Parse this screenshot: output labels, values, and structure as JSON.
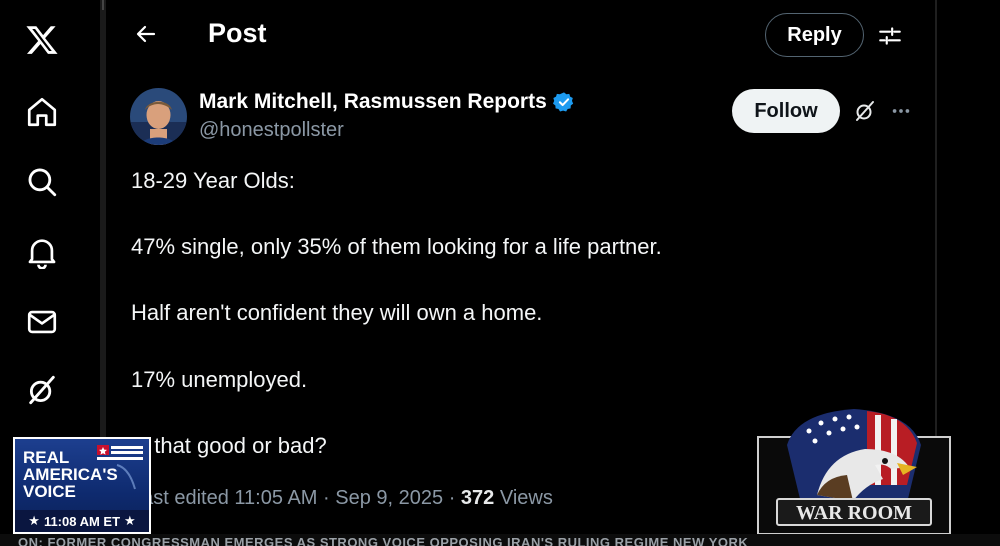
{
  "header": {
    "title": "Post",
    "reply_label": "Reply"
  },
  "author": {
    "name": "Mark Mitchell, Rasmussen Reports",
    "handle": "@honestpollster",
    "verified": true,
    "follow_label": "Follow"
  },
  "tweet": {
    "lines": [
      "18-29 Year Olds:",
      "47% single, only 35% of them looking for a life partner.",
      "Half aren't confident they will own a home.",
      "17% unemployed.",
      "Is that good or bad?"
    ]
  },
  "meta": {
    "edited_prefix": "Last edited",
    "time": "11:05 AM",
    "date": "Sep 9, 2025",
    "views_count": "372",
    "views_label": "Views",
    "separator": "·"
  },
  "nav": {
    "items": [
      "x-logo-icon",
      "home-icon",
      "search-icon",
      "notifications-icon",
      "messages-icon",
      "grok-icon"
    ]
  },
  "overlay": {
    "rav_line1": "REAL",
    "rav_line2": "AMERICA'S",
    "rav_line3": "VOICE",
    "rav_time": "11:08 AM ET",
    "warroom_label": "WAR ROOM",
    "ticker": "ON: FORMER CONGRESSMAN EMERGES AS STRONG VOICE OPPOSING IRAN'S RULING REGIME       NEW YORK"
  },
  "colors": {
    "background": "#000000",
    "verified": "#1d9bf0",
    "muted": "#8b98a5"
  }
}
